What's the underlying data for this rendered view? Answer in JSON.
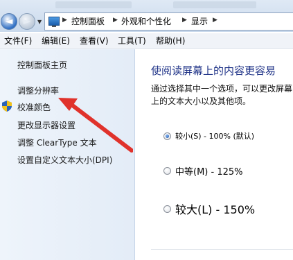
{
  "breadcrumb": {
    "items": [
      "控制面板",
      "外观和个性化",
      "显示"
    ]
  },
  "menubar": {
    "items": [
      "文件(F)",
      "编辑(E)",
      "查看(V)",
      "工具(T)",
      "帮助(H)"
    ]
  },
  "sidebar": {
    "links": [
      {
        "label": "控制面板主页"
      },
      {
        "label": "调整分辨率"
      },
      {
        "label": "校准颜色"
      },
      {
        "label": "更改显示器设置"
      },
      {
        "label": "调整 ClearType 文本"
      },
      {
        "label": "设置自定义文本大小(DPI)"
      }
    ]
  },
  "main": {
    "heading": "使阅读屏幕上的内容更容易",
    "description": "通过选择其中一个选项，可以更改屏幕上的文本大小以及其他项。",
    "options": [
      {
        "label": "较小(S) - 100% (默认)",
        "selected": true
      },
      {
        "label": "中等(M) - 125%",
        "selected": false
      },
      {
        "label": "较大(L) - 150%",
        "selected": false
      }
    ]
  },
  "colors": {
    "heading": "#1e3287",
    "annotation_arrow": "#e0322b",
    "sidebar_bg": "#e8f0f9"
  }
}
